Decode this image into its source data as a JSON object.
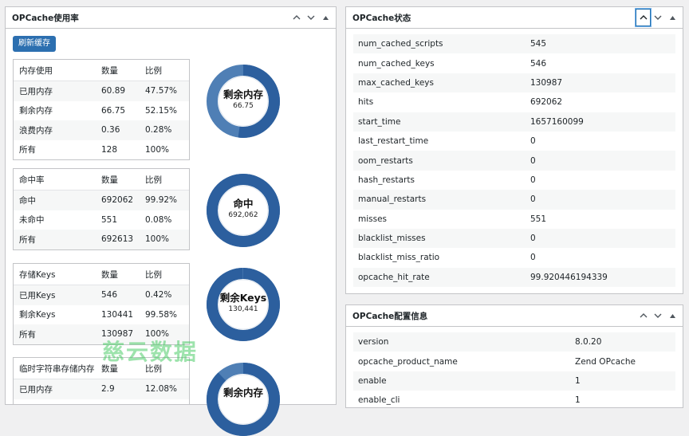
{
  "usage_panel": {
    "title": "OPCache使用率",
    "refresh_label": "刷新缓存",
    "tables": [
      {
        "header": [
          "内存使用",
          "数量",
          "比例"
        ],
        "rows": [
          [
            "已用内存",
            "60.89",
            "47.57%"
          ],
          [
            "剩余内存",
            "66.75",
            "52.15%"
          ],
          [
            "浪费内存",
            "0.36",
            "0.28%"
          ],
          [
            "所有",
            "128",
            "100%"
          ]
        ],
        "donut": {
          "title": "剩余内存",
          "value": "66.75",
          "fraction": 0.5215
        }
      },
      {
        "header": [
          "命中率",
          "数量",
          "比例"
        ],
        "rows": [
          [
            "命中",
            "692062",
            "99.92%"
          ],
          [
            "未命中",
            "551",
            "0.08%"
          ],
          [
            "所有",
            "692613",
            "100%"
          ]
        ],
        "donut": {
          "title": "命中",
          "value": "692,062",
          "fraction": 0.9992
        }
      },
      {
        "header": [
          "存储Keys",
          "数量",
          "比例"
        ],
        "rows": [
          [
            "已用Keys",
            "546",
            "0.42%"
          ],
          [
            "剩余Keys",
            "130441",
            "99.58%"
          ],
          [
            "所有",
            "130987",
            "100%"
          ]
        ],
        "donut": {
          "title": "剩余Keys",
          "value": "130,441",
          "fraction": 0.9958
        }
      },
      {
        "header": [
          "临时字符串存储内存",
          "数量",
          "比例"
        ],
        "rows": [
          [
            "已用内存",
            "2.9",
            "12.08%"
          ]
        ],
        "donut": {
          "title": "剩余内存",
          "value": "",
          "fraction": 0.8792
        }
      }
    ]
  },
  "status_panel": {
    "title": "OPCache状态",
    "rows": [
      [
        "num_cached_scripts",
        "545"
      ],
      [
        "num_cached_keys",
        "546"
      ],
      [
        "max_cached_keys",
        "130987"
      ],
      [
        "hits",
        "692062"
      ],
      [
        "start_time",
        "1657160099"
      ],
      [
        "last_restart_time",
        "0"
      ],
      [
        "oom_restarts",
        "0"
      ],
      [
        "hash_restarts",
        "0"
      ],
      [
        "manual_restarts",
        "0"
      ],
      [
        "misses",
        "551"
      ],
      [
        "blacklist_misses",
        "0"
      ],
      [
        "blacklist_miss_ratio",
        "0"
      ],
      [
        "opcache_hit_rate",
        "99.920446194339"
      ]
    ]
  },
  "config_panel": {
    "title": "OPCache配置信息",
    "rows": [
      [
        "version",
        "8.0.20"
      ],
      [
        "opcache_product_name",
        "Zend OPcache"
      ],
      [
        "enable",
        "1"
      ],
      [
        "enable_cli",
        "1"
      ]
    ]
  },
  "watermark": "慈云数据",
  "colors": {
    "donut_dark": "#2c5f9e",
    "donut_light": "#4f7fb5",
    "accent": "#2271b1"
  },
  "icons": [
    "chevron-up-icon",
    "chevron-down-icon",
    "triangle-up-icon"
  ]
}
